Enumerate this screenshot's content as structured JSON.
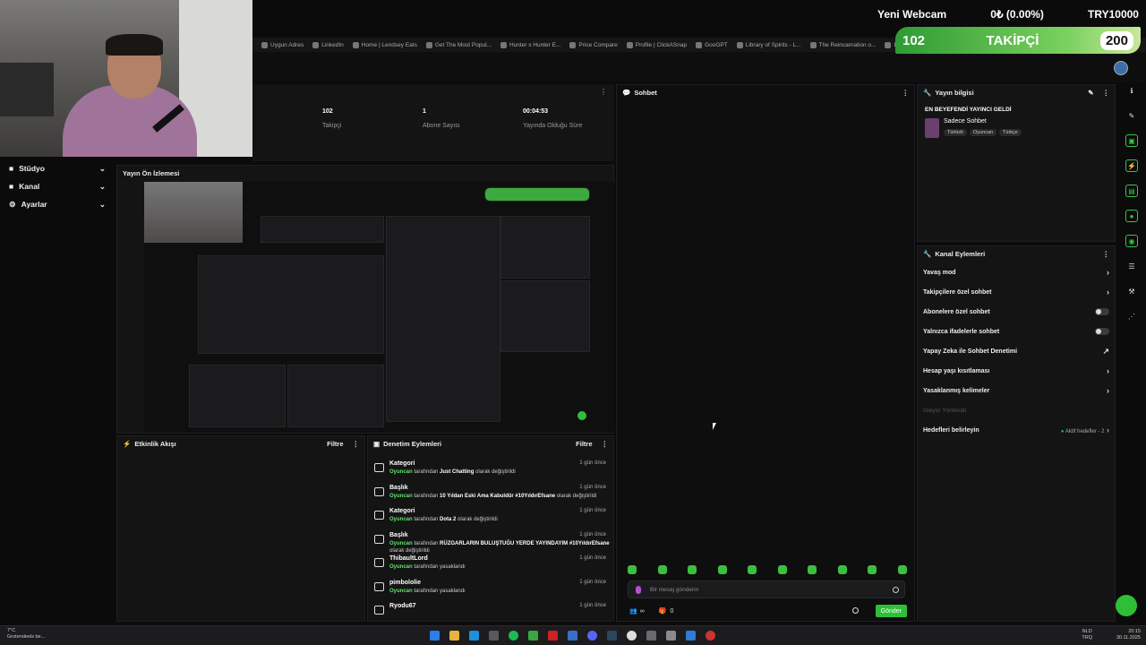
{
  "bookmarks": [
    "Uygun Adres",
    "LinkedIn",
    "Home | Lendsey Eats",
    "Get The Most Popul...",
    "Hunter x Hunter E...",
    "Price Compare",
    "Profile | ClickASnap",
    "GooGPT",
    "Library of Spirits - L...",
    "The Reincarnation o...",
    "Basics of Online M..."
  ],
  "overlay": {
    "title": "Yeni Webcam",
    "change": "0₺ (0.00%)",
    "currency": "TRY10000",
    "followers": "102",
    "label": "TAKİPÇİ",
    "goal": "200"
  },
  "nav": [
    {
      "label": "Stüdyo",
      "icon": "■"
    },
    {
      "label": "Kanal",
      "icon": "■"
    },
    {
      "label": "Ayarlar",
      "icon": "⚙"
    }
  ],
  "stats": [
    {
      "value": "102",
      "label": "Takipçi"
    },
    {
      "value": "1",
      "label": "Abone Sayısı"
    },
    {
      "value": "00:04:53",
      "label": "Yayında Olduğu Süre"
    }
  ],
  "preview": {
    "title": "Yayın Ön İzlemesi"
  },
  "activity": {
    "title": "Etkinlik Akışı",
    "filter": "Filtre"
  },
  "mod": {
    "title": "Denetim Eylemleri",
    "filter": "Filtre",
    "rows": [
      {
        "title": "Kategori",
        "by": "Oyuncan",
        "pre": " tarafından ",
        "highlight": "Just Chatting",
        "post": " olarak değiştirildi",
        "time": "1 gün önce"
      },
      {
        "title": "Başlık",
        "by": "Oyuncan",
        "pre": " tarafından ",
        "highlight": "10 Yıldan Eski Ama Kabuldür #10YıldırEfsane",
        "post": " olarak değiştirildi",
        "time": "1 gün önce"
      },
      {
        "title": "Kategori",
        "by": "Oyuncan",
        "pre": " tarafından ",
        "highlight": "Dota 2",
        "post": " olarak değiştirildi",
        "time": "1 gün önce"
      },
      {
        "title": "Başlık",
        "by": "Oyuncan",
        "pre": " tarafından ",
        "highlight": "RÜZGARLARIN BULUŞTUĞU YERDE YAYINDAYIM #10YıldırEfsane",
        "post": " olarak değiştirildi",
        "time": "1 gün önce"
      },
      {
        "title": "ThibaultLord",
        "by": "Oyuncan",
        "pre": " tarafından yasaklandı",
        "highlight": "",
        "post": "",
        "time": "1 gün önce"
      },
      {
        "title": "pimbololie",
        "by": "Oyuncan",
        "pre": " tarafından yasaklandı",
        "highlight": "",
        "post": "",
        "time": "1 gün önce"
      },
      {
        "title": "Ryodu67",
        "by": "",
        "pre": "",
        "highlight": "",
        "post": "",
        "time": "1 gün önce"
      }
    ]
  },
  "chat": {
    "title": "Sohbet",
    "placeholder": "Bir mesaj gönderin",
    "viewers": "∞",
    "count": "0",
    "send": "Gönder"
  },
  "info": {
    "title": "Yayın bilgisi",
    "stream_title": "EN BEYEFENDİ YAYINCI GELDİ",
    "category": "Sadece Sohbet",
    "tags": [
      "Türkish",
      "Oyuncan",
      "Türkçe"
    ]
  },
  "actions": {
    "title": "Kanal Eylemleri",
    "items": [
      {
        "label": "Yavaş mod",
        "control": "chevron"
      },
      {
        "label": "Takipçilere özel sohbet",
        "control": "chevron"
      },
      {
        "label": "Abonelere özel sohbet",
        "control": "toggle"
      },
      {
        "label": "Yalnızca ifadelerle sohbet",
        "control": "toggle"
      },
      {
        "label": "Yapay Zeka ile Sohbet Denetimi",
        "control": "external"
      },
      {
        "label": "Hesap yaşı kısıtlaması",
        "control": "chevron"
      },
      {
        "label": "Yasaklanmış kelimeler",
        "control": "chevron"
      },
      {
        "label": "İzleyici Yönlendir",
        "control": "none"
      },
      {
        "label": "Hedefleri belirleyin",
        "control": "goal"
      }
    ],
    "goal_text": "Aktif hedefler - 2"
  },
  "taskbar": {
    "weather_temp": "7°C",
    "weather_place": "Grotendeels be...",
    "lang": "NLD",
    "lang2": "TRQ",
    "time": "20:15",
    "date": "30.11.2025"
  },
  "colors": {
    "accent": "#2fbf37",
    "panel": "#141415"
  }
}
